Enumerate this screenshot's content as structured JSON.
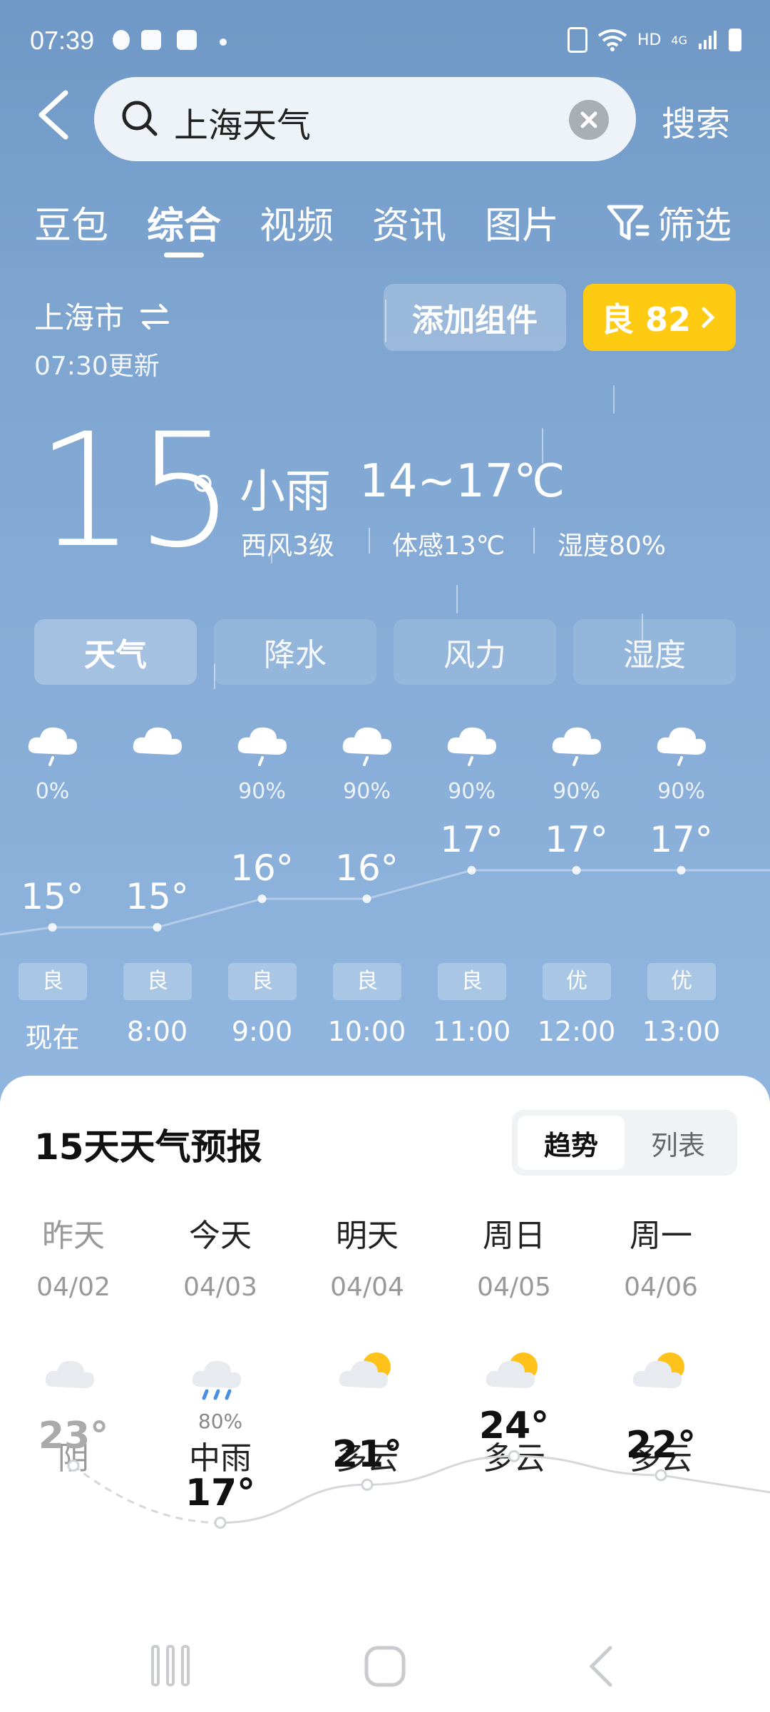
{
  "status_bar": {
    "time": "07:39",
    "network_type": "HD",
    "signal_type": "4G",
    "icons": [
      "penguin-icon",
      "voicemail-icon",
      "clock-icon",
      "dot-icon",
      "battery-saver-icon",
      "wifi-icon",
      "signal-icon",
      "battery-icon"
    ]
  },
  "search": {
    "query": "上海天气",
    "button_label": "搜索"
  },
  "tabs": [
    {
      "label": "豆包"
    },
    {
      "label": "综合",
      "active": true
    },
    {
      "label": "视频"
    },
    {
      "label": "资讯"
    },
    {
      "label": "图片"
    }
  ],
  "filter_label": "筛选",
  "weather": {
    "city": "上海市",
    "updated": "07:30更新",
    "add_widget_label": "添加组件",
    "aqi_label": "良 82",
    "current_temp": "15",
    "degree_symbol": "°",
    "condition": "小雨",
    "range": "14~17℃",
    "wind": "西风3级",
    "feels_like": "体感13℃",
    "humidity": "湿度80%"
  },
  "metric_chips": [
    {
      "label": "天气",
      "active": true
    },
    {
      "label": "降水"
    },
    {
      "label": "风力"
    },
    {
      "label": "湿度"
    }
  ],
  "hourly": [
    {
      "time": "现在",
      "icon": "light-rain-cloud-icon",
      "precip": "0%",
      "temp": "15°",
      "temp_value": 15,
      "aqi": "良"
    },
    {
      "time": "8:00",
      "icon": "cloud-icon",
      "precip": "",
      "temp": "15°",
      "temp_value": 15,
      "aqi": "良"
    },
    {
      "time": "9:00",
      "icon": "light-rain-cloud-icon",
      "precip": "90%",
      "temp": "16°",
      "temp_value": 16,
      "aqi": "良"
    },
    {
      "time": "10:00",
      "icon": "light-rain-cloud-icon",
      "precip": "90%",
      "temp": "16°",
      "temp_value": 16,
      "aqi": "良"
    },
    {
      "time": "11:00",
      "icon": "light-rain-cloud-icon",
      "precip": "90%",
      "temp": "17°",
      "temp_value": 17,
      "aqi": "良"
    },
    {
      "time": "12:00",
      "icon": "light-rain-cloud-icon",
      "precip": "90%",
      "temp": "17°",
      "temp_value": 17,
      "aqi": "优"
    },
    {
      "time": "13:00",
      "icon": "light-rain-cloud-icon",
      "precip": "90%",
      "temp": "17°",
      "temp_value": 17,
      "aqi": "优"
    }
  ],
  "forecast": {
    "title": "15天天气预报",
    "toggle": {
      "trend": "趋势",
      "list": "列表"
    },
    "days": [
      {
        "name": "昨天",
        "date": "04/02",
        "icon": "overcast-cloud-icon",
        "precip": "",
        "weather": "阴",
        "high": "23°",
        "high_value": 23,
        "past": true
      },
      {
        "name": "今天",
        "date": "04/03",
        "icon": "rain-cloud-icon",
        "precip": "80%",
        "weather": "中雨",
        "high": "17°",
        "high_value": 17,
        "past": false
      },
      {
        "name": "明天",
        "date": "04/04",
        "icon": "partly-cloudy-icon",
        "precip": "",
        "weather": "多云",
        "high": "21°",
        "high_value": 21,
        "past": false
      },
      {
        "name": "周日",
        "date": "04/05",
        "icon": "partly-cloudy-icon",
        "precip": "",
        "weather": "多云",
        "high": "24°",
        "high_value": 24,
        "past": false
      },
      {
        "name": "周一",
        "date": "04/06",
        "icon": "partly-cloudy-icon",
        "precip": "",
        "weather": "多云",
        "high": "22°",
        "high_value": 22,
        "past": false
      }
    ]
  },
  "colors": {
    "sky_top": "#6f98c6",
    "sky_bottom": "#9bbde3",
    "aqi_yellow": "#ffca12",
    "sheet_bg": "#ffffff"
  }
}
